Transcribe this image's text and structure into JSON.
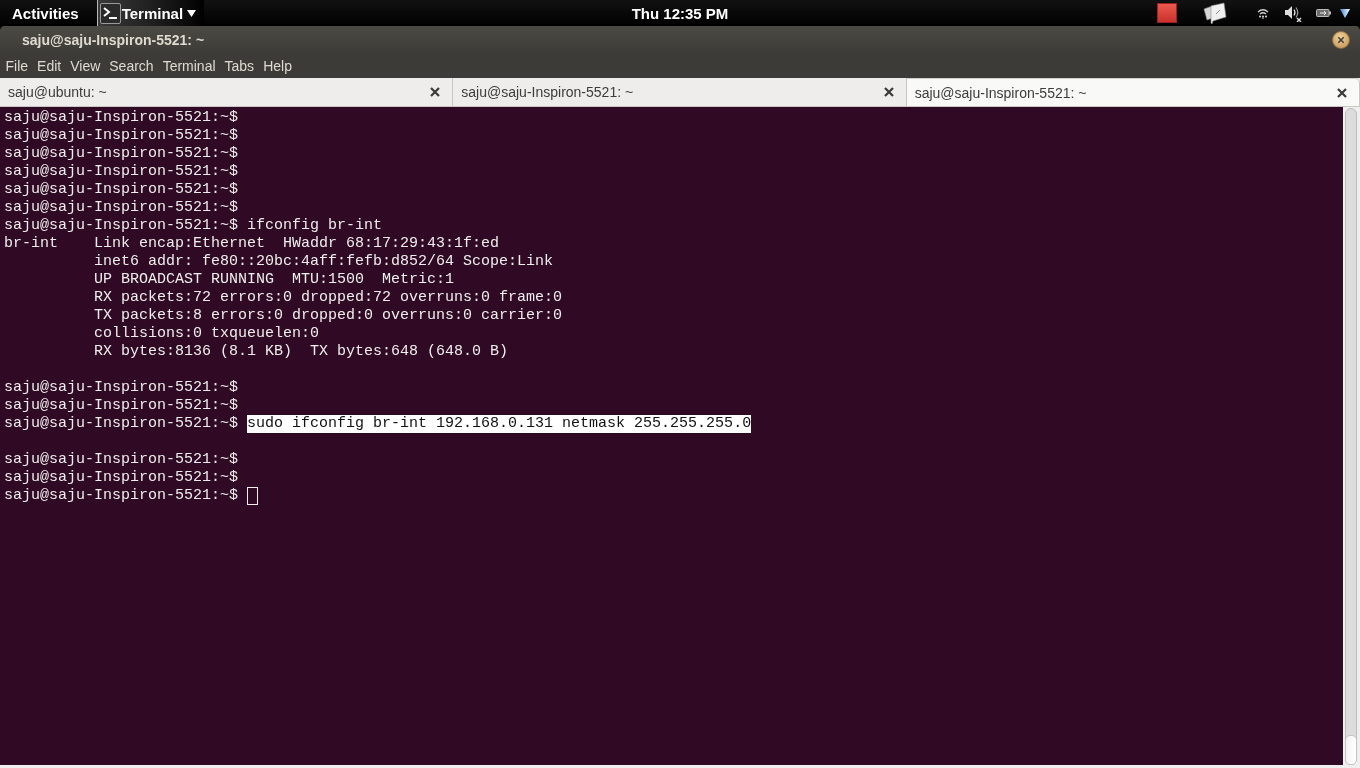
{
  "top_panel": {
    "activities": "Activities",
    "app_menu": "Terminal",
    "clock": "Thu 12:35 PM"
  },
  "window": {
    "title": "saju@saju-Inspiron-5521: ~"
  },
  "menu_bar": [
    "File",
    "Edit",
    "View",
    "Search",
    "Terminal",
    "Tabs",
    "Help"
  ],
  "tabs": [
    {
      "label": "saju@ubuntu: ~",
      "selected": false
    },
    {
      "label": "saju@saju-Inspiron-5521: ~",
      "selected": false
    },
    {
      "label": "saju@saju-Inspiron-5521: ~",
      "selected": true
    }
  ],
  "terminal": {
    "lines": [
      {
        "kind": "prompt",
        "prompt": "saju@saju-Inspiron-5521:~$",
        "cursor": false
      },
      {
        "kind": "prompt",
        "prompt": "saju@saju-Inspiron-5521:~$",
        "cursor": false
      },
      {
        "kind": "prompt",
        "prompt": "saju@saju-Inspiron-5521:~$",
        "cursor": false
      },
      {
        "kind": "prompt",
        "prompt": "saju@saju-Inspiron-5521:~$",
        "cursor": false
      },
      {
        "kind": "prompt",
        "prompt": "saju@saju-Inspiron-5521:~$",
        "cursor": false
      },
      {
        "kind": "prompt",
        "prompt": "saju@saju-Inspiron-5521:~$",
        "cursor": false
      },
      {
        "kind": "command",
        "prompt": "saju@saju-Inspiron-5521:~$",
        "command": "ifconfig br-int",
        "selected": false
      },
      {
        "kind": "output",
        "text": "br-int    Link encap:Ethernet  HWaddr 68:17:29:43:1f:ed"
      },
      {
        "kind": "output",
        "text": "          inet6 addr: fe80::20bc:4aff:fefb:d852/64 Scope:Link"
      },
      {
        "kind": "output",
        "text": "          UP BROADCAST RUNNING  MTU:1500  Metric:1"
      },
      {
        "kind": "output",
        "text": "          RX packets:72 errors:0 dropped:72 overruns:0 frame:0"
      },
      {
        "kind": "output",
        "text": "          TX packets:8 errors:0 dropped:0 overruns:0 carrier:0"
      },
      {
        "kind": "output",
        "text": "          collisions:0 txqueuelen:0"
      },
      {
        "kind": "output",
        "text": "          RX bytes:8136 (8.1 KB)  TX bytes:648 (648.0 B)"
      },
      {
        "kind": "blank"
      },
      {
        "kind": "prompt",
        "prompt": "saju@saju-Inspiron-5521:~$",
        "cursor": false
      },
      {
        "kind": "prompt",
        "prompt": "saju@saju-Inspiron-5521:~$",
        "cursor": false
      },
      {
        "kind": "command",
        "prompt": "saju@saju-Inspiron-5521:~$",
        "command": "sudo ifconfig br-int 192.168.0.131 netmask 255.255.255.0",
        "selected": true
      },
      {
        "kind": "blank"
      },
      {
        "kind": "prompt",
        "prompt": "saju@saju-Inspiron-5521:~$",
        "cursor": false
      },
      {
        "kind": "prompt",
        "prompt": "saju@saju-Inspiron-5521:~$",
        "cursor": false
      },
      {
        "kind": "prompt",
        "prompt": "saju@saju-Inspiron-5521:~$",
        "cursor": true
      }
    ]
  }
}
